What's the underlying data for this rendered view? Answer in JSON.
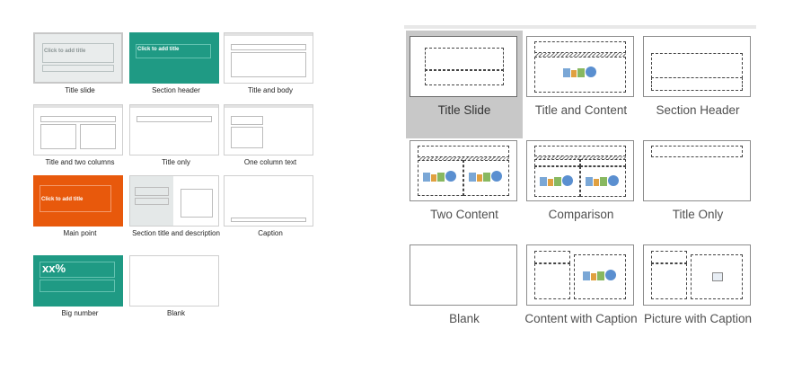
{
  "google_layouts": {
    "placeholders": {
      "title": "Click to add title",
      "title_small": "Click to add title",
      "subtitle": "subtitle",
      "big_number": "xx%"
    },
    "items": [
      {
        "label": "Title slide"
      },
      {
        "label": "Section header"
      },
      {
        "label": "Title and body"
      },
      {
        "label": "Title and two columns"
      },
      {
        "label": "Title only"
      },
      {
        "label": "One column text"
      },
      {
        "label": "Main point"
      },
      {
        "label": "Section title and description"
      },
      {
        "label": "Caption"
      },
      {
        "label": "Big number"
      },
      {
        "label": "Blank"
      }
    ],
    "colors": {
      "teal": "#1f9a84",
      "orange": "#e8590c"
    }
  },
  "powerpoint_layouts": {
    "items": [
      {
        "label": "Title Slide",
        "selected": true
      },
      {
        "label": "Title and Content"
      },
      {
        "label": "Section Header"
      },
      {
        "label": "Two Content"
      },
      {
        "label": "Comparison"
      },
      {
        "label": "Title Only"
      },
      {
        "label": "Blank"
      },
      {
        "label": "Content with Caption"
      },
      {
        "label": "Picture with Caption"
      }
    ]
  }
}
